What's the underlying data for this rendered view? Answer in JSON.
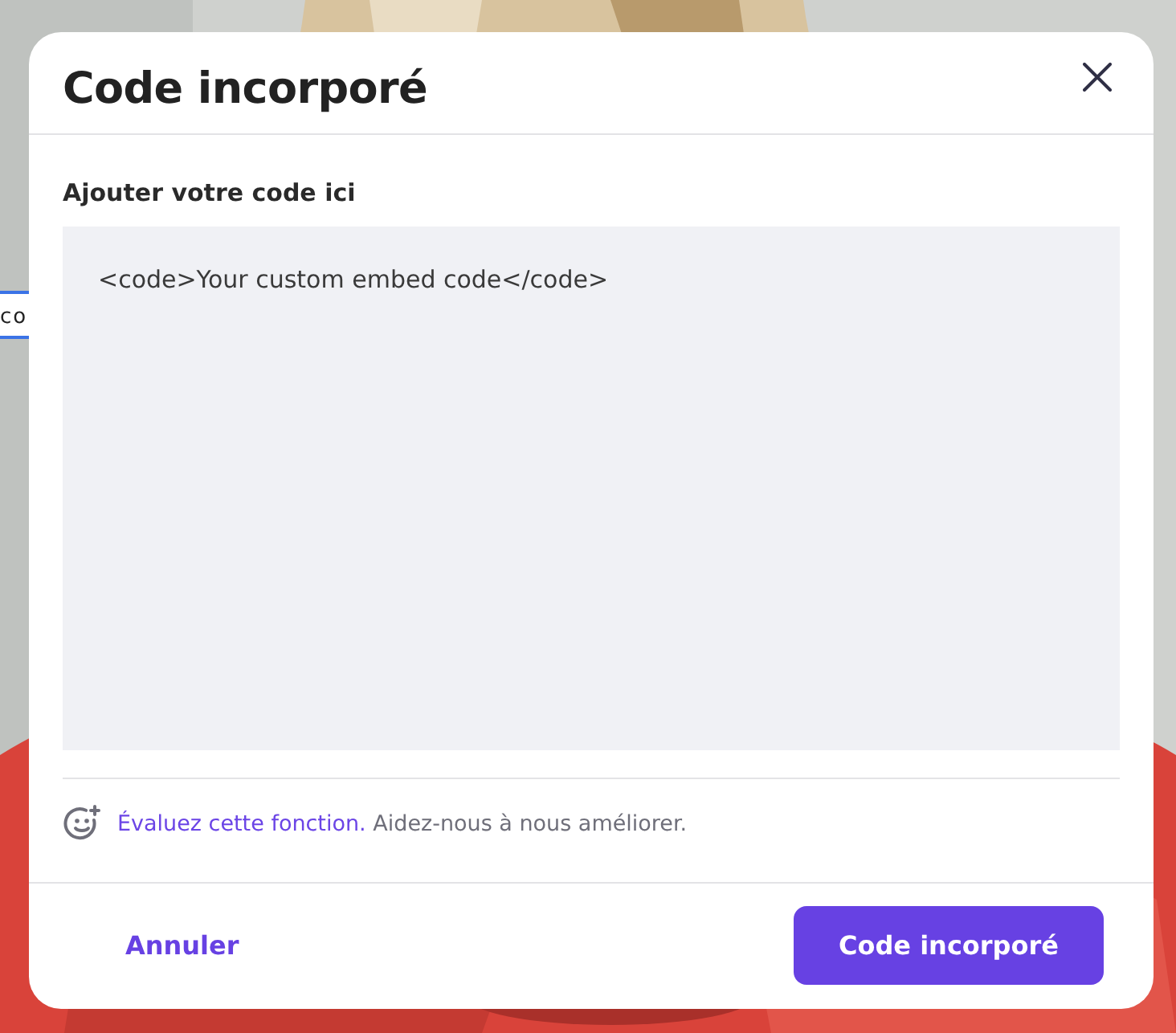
{
  "background": {
    "kind": "picture",
    "field_text": "co"
  },
  "dialog": {
    "title": "Code incorporé",
    "label": "Ajouter votre code ici",
    "code_value": "<code>Your custom embed code</code>",
    "feedback": {
      "link": "Évaluez cette fonction.",
      "text": "Aidez-nous à nous améliorer."
    },
    "buttons": [
      {
        "kind": "secondary",
        "label": "Annuler"
      },
      {
        "kind": "primary",
        "label": "Code incorporé"
      }
    ]
  }
}
